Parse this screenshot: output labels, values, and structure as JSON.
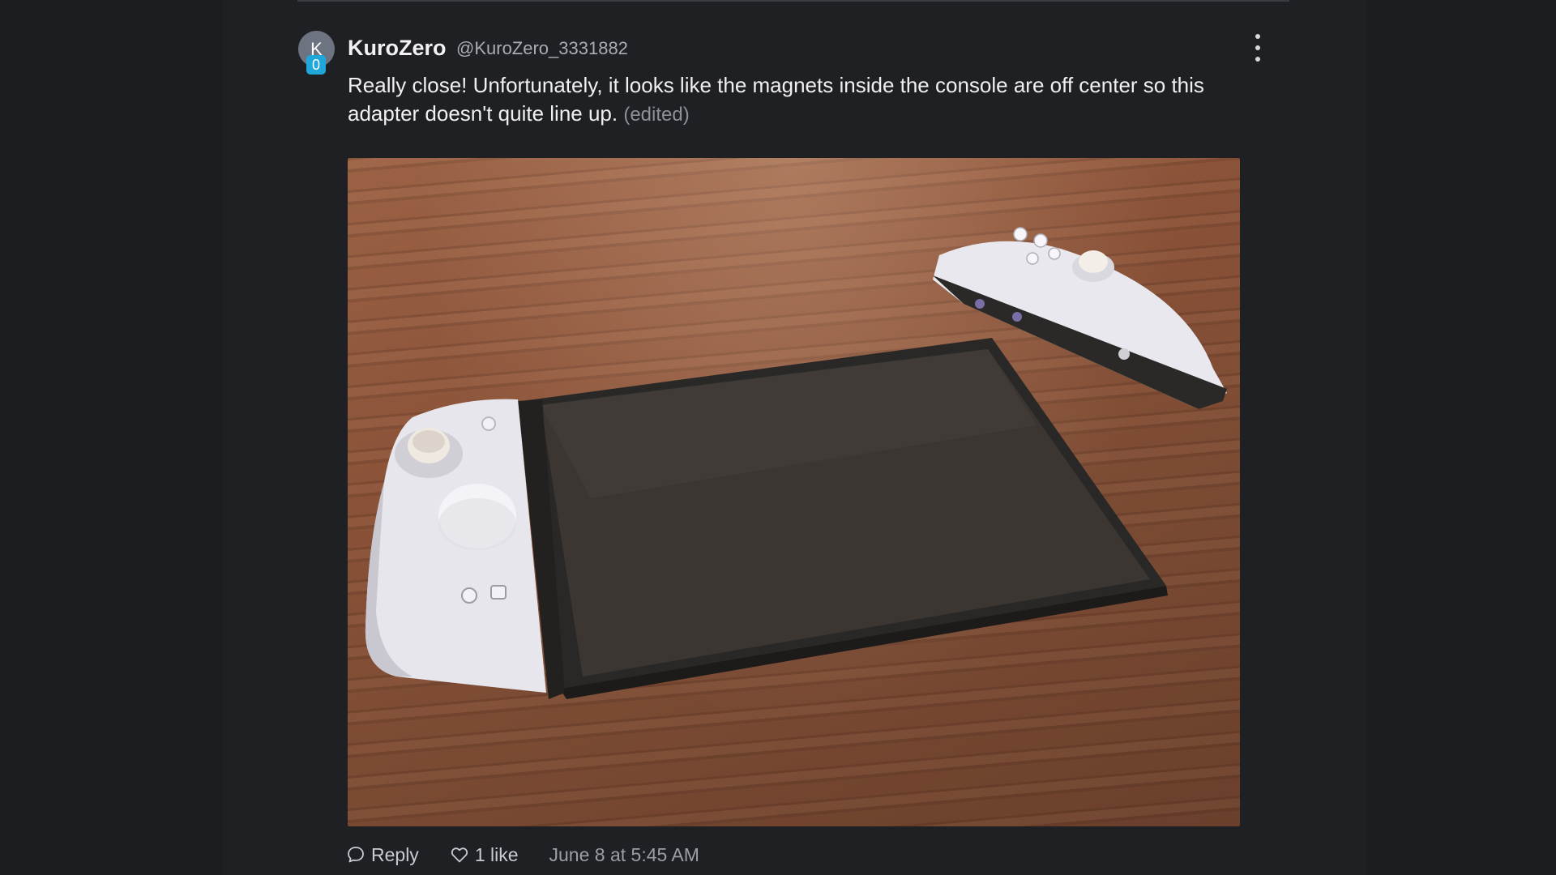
{
  "post": {
    "avatar_letter": "K",
    "avatar_badge": "0",
    "username": "KuroZero",
    "handle": "@KuroZero_3331882",
    "message": "Really close! Unfortunately, it looks like the magnets inside the console are off center so this adapter doesn't quite line up.",
    "edited_label": "(edited)"
  },
  "actions": {
    "reply_label": "Reply",
    "like_label": "1 like",
    "timestamp": "June 8 at 5:45 AM"
  },
  "icons": {
    "more": "more-vertical-icon",
    "reply": "speech-bubble-icon",
    "like": "heart-icon"
  },
  "colors": {
    "background": "#1c1d21",
    "badge": "#1ea7d8",
    "avatar": "#6d7380"
  }
}
